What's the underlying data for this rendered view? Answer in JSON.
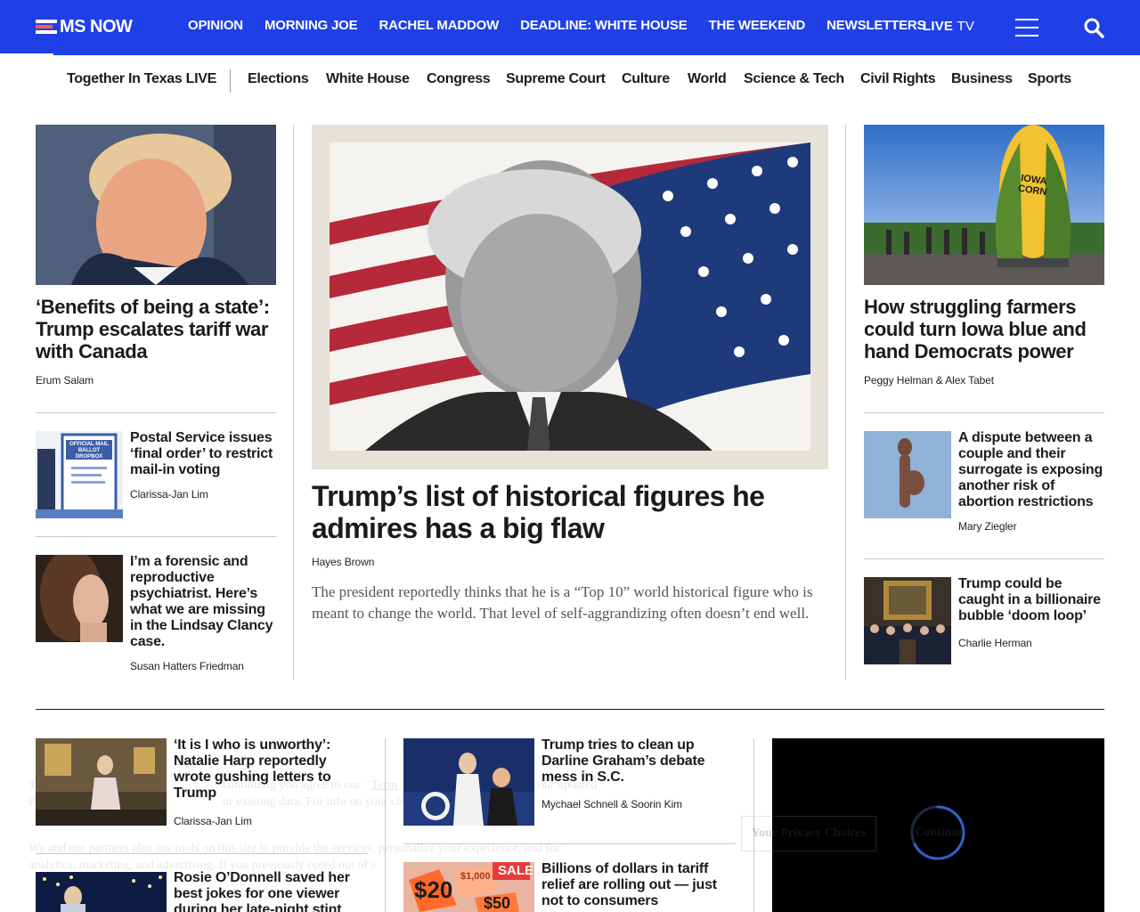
{
  "header": {
    "logo_text": "MS NOW",
    "nav": [
      "OPINION",
      "MORNING JOE",
      "RACHEL MADDOW",
      "DEADLINE: WHITE HOUSE",
      "THE WEEKEND",
      "NEWSLETTERS"
    ],
    "live": "LIVE",
    "tv": "TV"
  },
  "subnav": {
    "items": [
      "Together In Texas LIVE",
      "Elections",
      "White House",
      "Congress",
      "Supreme Court",
      "Culture",
      "World",
      "Science & Tech",
      "Civil Rights",
      "Business",
      "Sports"
    ]
  },
  "left": {
    "lead": {
      "headline": "‘Benefits of being a state’: Trump escalates tariff war with Canada",
      "byline": "Erum Salam"
    },
    "story1": {
      "headline": "Postal Service issues ‘final order’ to restrict mail-in voting",
      "byline": "Clarissa-Jan Lim"
    },
    "story2": {
      "headline": "I’m a forensic and reproductive psychiatrist. Here’s what we are missing in the Lindsay Clancy case.",
      "byline": "Susan Hatters Friedman"
    }
  },
  "center": {
    "headline": "Trump’s list of historical figures he admires has a big flaw",
    "byline": "Hayes Brown",
    "dek": "The president reportedly thinks that he is a “Top 10” world historical figure who is meant to change the world. That level of self-aggrandizing often doesn’t end well."
  },
  "right": {
    "lead": {
      "headline": "How struggling farmers could turn Iowa blue and hand Democrats power",
      "byline": "Peggy Helman & Alex Tabet"
    },
    "story1": {
      "headline": "A dispute between a couple and their surrogate is exposing another risk of abortion restrictions",
      "byline": "Mary Ziegler"
    },
    "story2": {
      "headline": "Trump could be caught in a billionaire bubble ‘doom loop’",
      "byline": "Charlie Herman"
    }
  },
  "lower": {
    "a1": {
      "headline": "‘It is I who is unworthy’: Natalie Harp reportedly wrote gushing letters to Trump",
      "byline": "Clarissa-Jan Lim"
    },
    "a2": {
      "headline": "Rosie O’Donnell saved her best jokes for one viewer during her late-night stint"
    },
    "b1": {
      "headline": "Trump tries to clean up Darline Graham’s debate mess in S.C.",
      "byline": "Mychael Schnell & Soorin Kim"
    },
    "b2": {
      "headline": "Billions of dollars in tariff relief are rolling out — just not to consumers"
    }
  },
  "consent": {
    "line1a": "Th",
    "line1b": "continuing you agree to our",
    "terms": "Term",
    "line1c": "and our updated",
    "line2a": "Pr",
    "line2b": "ur existing data. For info on your ch",
    "line3": "We and our partners also use tools on this site to provide the services, personalize your experience, and for",
    "line4": "analytics, marketing, and advertising. If you previously opted out of s",
    "privacy_btn": "Your Privacy Choices",
    "continue_btn": "Continue"
  },
  "images": {
    "sale_tag": "SALE",
    "price1": "$1,000",
    "price2": "$20",
    "price3": "$50",
    "sign": "IOWA CORN",
    "ballot": "OFFICIAL MAIL BALLOT DROPBOX"
  },
  "colors": {
    "brand_blue": "#1f40e6",
    "accent_red": "#ff5a4a"
  }
}
